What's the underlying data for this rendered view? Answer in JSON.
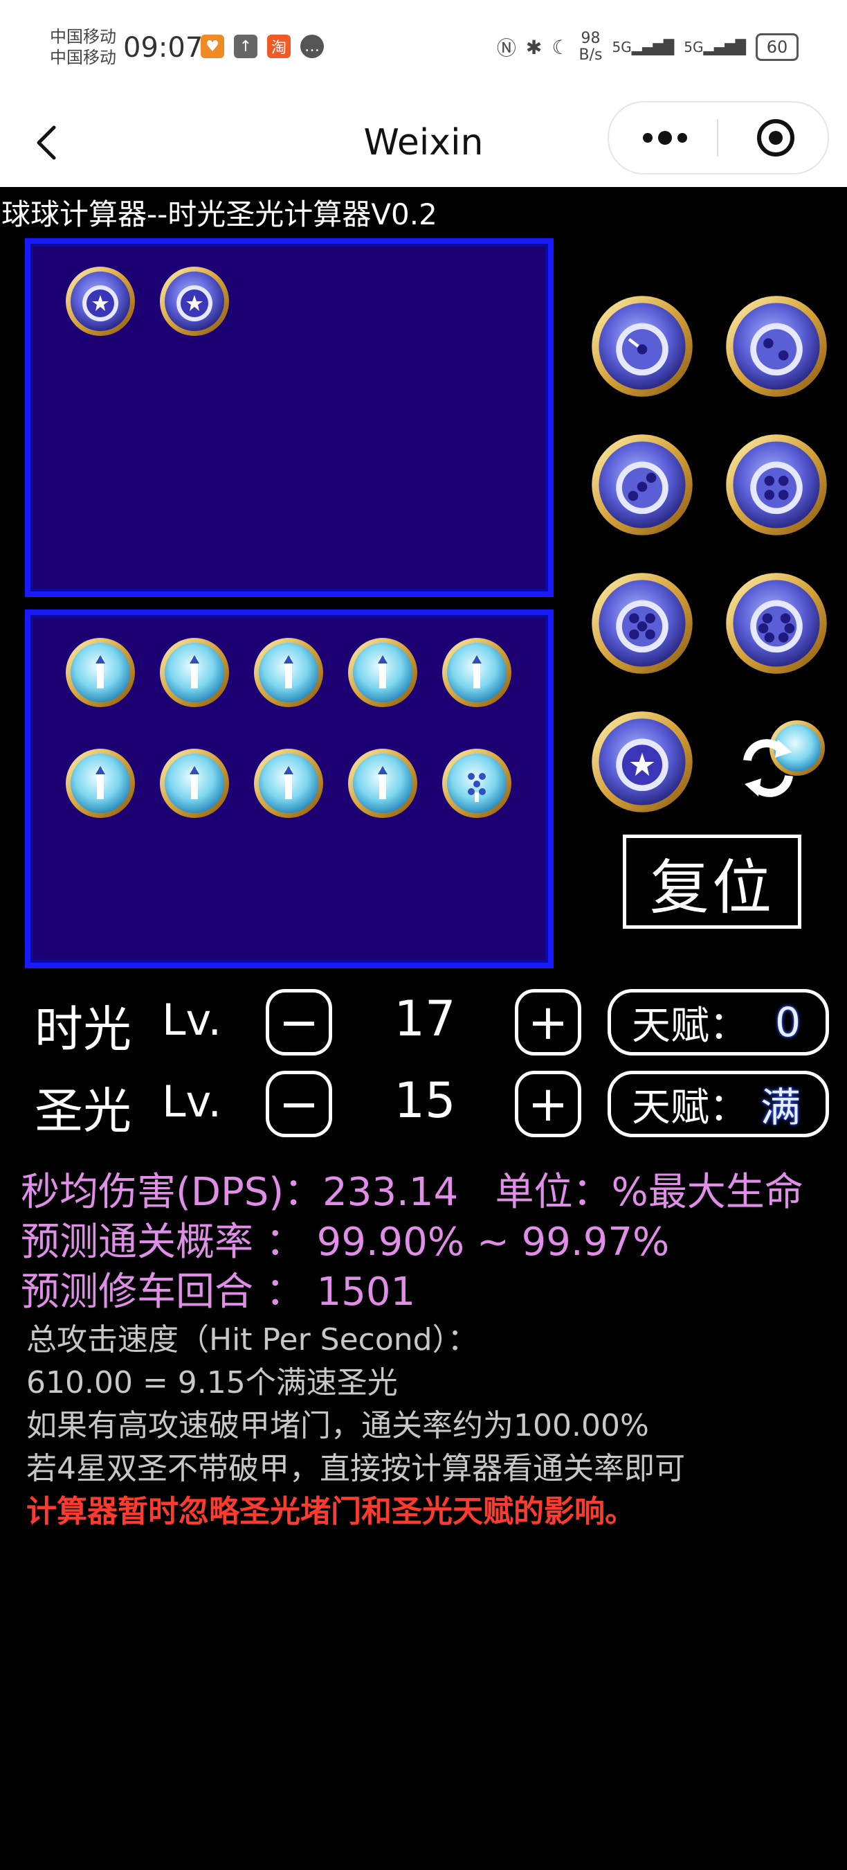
{
  "status_bar": {
    "carrier_1": "中国移动",
    "carrier_2": "中国移动",
    "time": "09:07",
    "net_speed_value": "98",
    "net_speed_unit": "B/s",
    "signal_1": "5G",
    "signal_2": "5G",
    "battery": "60",
    "app_icons": [
      "taobao-app-icon",
      "upload-icon",
      "taobao-icon",
      "message-icon"
    ]
  },
  "nav": {
    "title": "Weixin"
  },
  "app": {
    "title": "球球计算器--时光圣光计算器V0.2"
  },
  "panels": {
    "top_orbs": [
      "time-orb-star",
      "time-orb-star"
    ],
    "bottom_orbs": [
      "holy-orb",
      "holy-orb",
      "holy-orb",
      "holy-orb",
      "holy-orb",
      "holy-orb",
      "holy-orb",
      "holy-orb",
      "holy-orb",
      "holy-orb-dots"
    ]
  },
  "palette": {
    "time_orbs": [
      "time-orb-1",
      "time-orb-2",
      "time-orb-3",
      "time-orb-4",
      "time-orb-5",
      "time-orb-6",
      "time-orb-star"
    ],
    "swap_icon": "refresh-icon"
  },
  "controls": {
    "reset_label": "复位",
    "rows": [
      {
        "name": "时光",
        "lv_label": "Lv.",
        "level": "17",
        "talent_label": "天赋：",
        "talent_value": "0"
      },
      {
        "name": "圣光",
        "lv_label": "Lv.",
        "level": "15",
        "talent_label": "天赋：",
        "talent_value": "满"
      }
    ]
  },
  "stats": {
    "dps": "秒均伤害(DPS)：233.14   单位：%最大生命",
    "clear_rate": "预测通关概率 ： 99.90% ~ 99.97%",
    "repair_round": "预测修车回合 ： 1501",
    "hps_label": "总攻击速度（Hit Per Second）：",
    "hps_value": "610.00 = 9.15个满速圣光",
    "note_1": "如果有高攻速破甲堵门，通关率约为100.00%",
    "note_2": "若4星双圣不带破甲，直接按计算器看通关率即可",
    "warning": "计算器暂时忽略圣光堵门和圣光天赋的影响。"
  },
  "colors": {
    "panel_bg": "#1c0073",
    "panel_border": "#1a1aff",
    "stat_text": "#e18ee8",
    "warning_text": "#ff3b2f"
  }
}
